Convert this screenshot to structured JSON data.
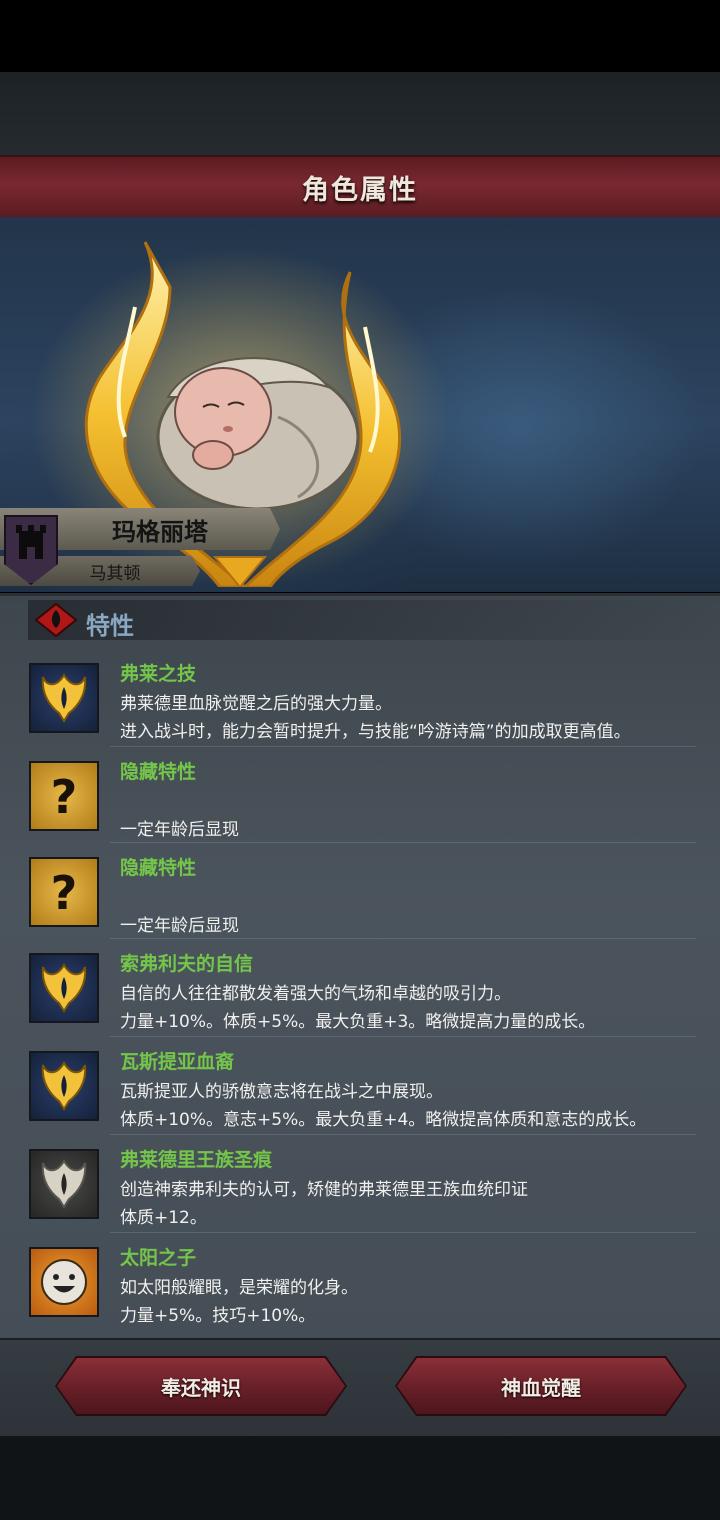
{
  "header": {
    "title": "角色属性"
  },
  "character": {
    "name": "玛格丽塔",
    "origin": "马其顿"
  },
  "traits_section": {
    "title": "特性"
  },
  "traits": [
    {
      "name": "弗莱之技",
      "icon": "golden-flame-crest-icon",
      "lines": [
        "弗莱德里血脉觉醒之后的强大力量。",
        "进入战斗时，能力会暂时提升，与技能“吟游诗篇”的加成取更高值。"
      ]
    },
    {
      "name": "隐藏特性",
      "icon": "question-mark-icon",
      "lines": [
        "",
        "一定年龄后显现"
      ]
    },
    {
      "name": "隐藏特性",
      "icon": "question-mark-icon",
      "lines": [
        "",
        "一定年龄后显现"
      ]
    },
    {
      "name": "索弗利夫的自信",
      "icon": "golden-flame-crest-icon",
      "lines": [
        "自信的人往往都散发着强大的气场和卓越的吸引力。",
        "力量+10%。体质+5%。最大负重+3。略微提高力量的成长。"
      ]
    },
    {
      "name": "瓦斯提亚血裔",
      "icon": "golden-flame-crest-icon",
      "lines": [
        "瓦斯提亚人的骄傲意志将在战斗之中展现。",
        "体质+10%。意志+5%。最大负重+4。略微提高体质和意志的成长。"
      ]
    },
    {
      "name": "弗莱德里王族圣痕",
      "icon": "silver-flame-crest-icon",
      "lines": [
        "创造神索弗利夫的认可，矫健的弗莱德里王族血统印证",
        "体质+12。"
      ]
    },
    {
      "name": "太阳之子",
      "icon": "smiley-sun-icon",
      "lines": [
        "如太阳般耀眼，是荣耀的化身。",
        "力量+5%。技巧+10%。"
      ]
    }
  ],
  "buttons": {
    "return_label": "奉还神识",
    "awaken_label": "神血觉醒"
  },
  "colors": {
    "trait_name": "#74c64a",
    "title_bar": "#7a2830",
    "button": "#6a2029"
  }
}
